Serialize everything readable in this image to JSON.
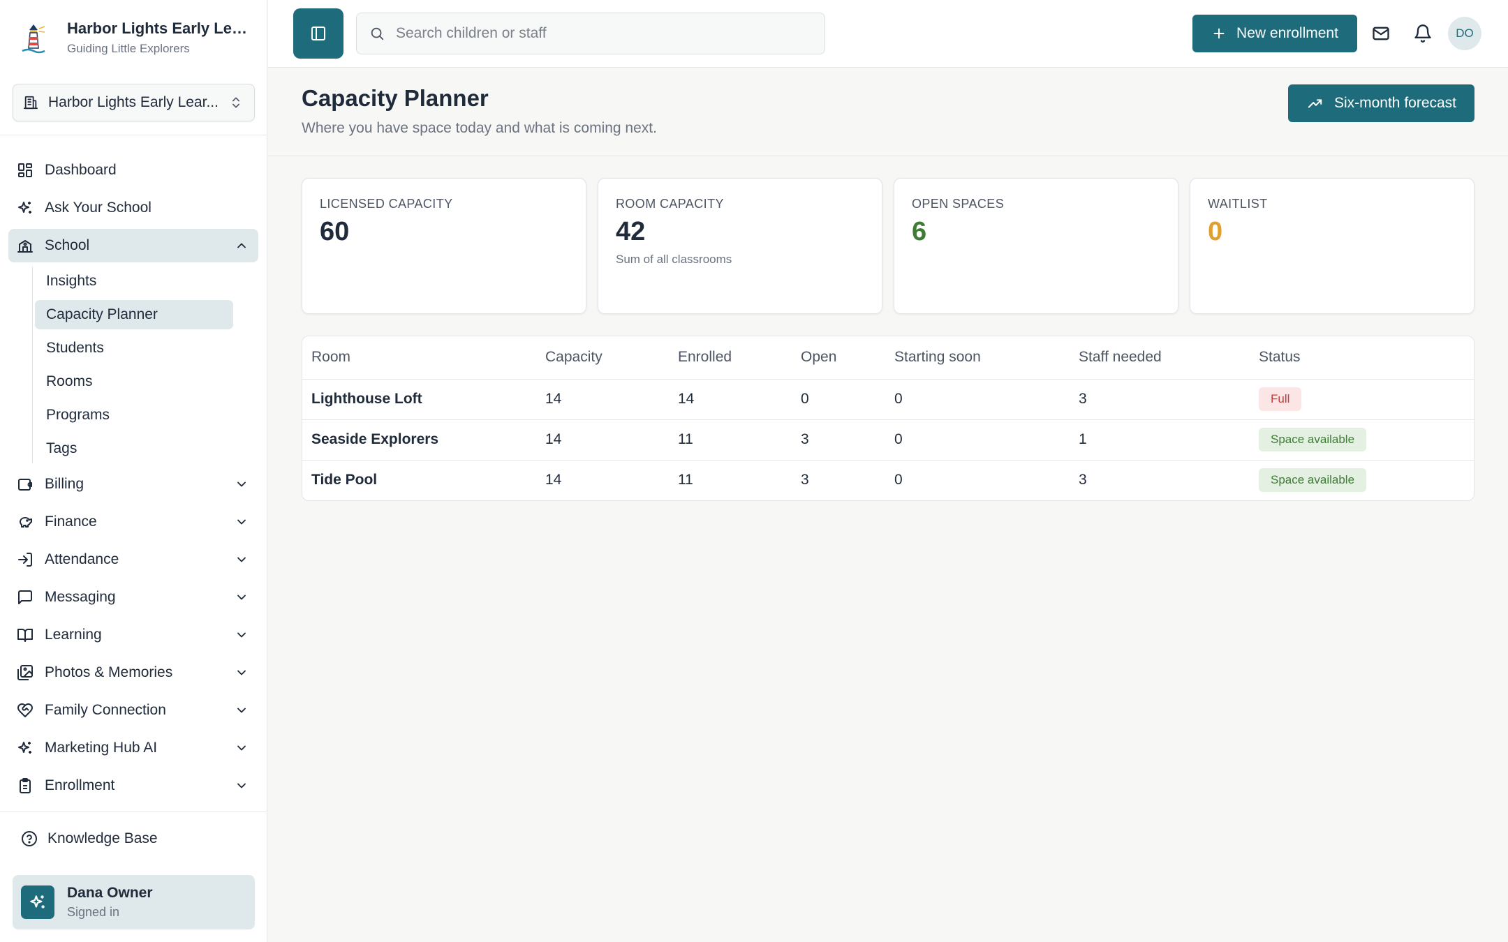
{
  "colors": {
    "primary": "#1e6b7b",
    "active_bg": "#dfe9ec",
    "open_spaces": "#3f7a36",
    "waitlist": "#e0a030",
    "full_bg": "#fbe5e5",
    "full_text": "#c43b3b",
    "available_bg": "#e4f0e2",
    "available_text": "#3f7a36"
  },
  "brand": {
    "name": "Harbor Lights Early Learn...",
    "tagline": "Guiding Little Explorers",
    "icon": "lighthouse-icon"
  },
  "school_selector": {
    "value": "Harbor Lights Early Lear...",
    "icon": "building-icon"
  },
  "sidebar": {
    "items": [
      {
        "label": "Dashboard",
        "icon": "dashboard-icon"
      },
      {
        "label": "Ask Your School",
        "icon": "sparkles-icon"
      },
      {
        "label": "School",
        "icon": "school-icon",
        "expanded": true,
        "children": [
          "Insights",
          "Capacity Planner",
          "Students",
          "Rooms",
          "Programs",
          "Tags"
        ],
        "active_child": "Capacity Planner"
      },
      {
        "label": "Billing",
        "icon": "wallet-icon"
      },
      {
        "label": "Finance",
        "icon": "piggy-bank-icon"
      },
      {
        "label": "Attendance",
        "icon": "sign-in-icon"
      },
      {
        "label": "Messaging",
        "icon": "message-square-icon"
      },
      {
        "label": "Learning",
        "icon": "book-open-icon"
      },
      {
        "label": "Photos & Memories",
        "icon": "images-icon"
      },
      {
        "label": "Family Connection",
        "icon": "heart-handshake-icon"
      },
      {
        "label": "Marketing Hub AI",
        "icon": "sparkles-icon"
      },
      {
        "label": "Enrollment",
        "icon": "clipboard-icon"
      }
    ],
    "knowledge_base": "Knowledge Base",
    "user": {
      "name": "Dana Owner",
      "status": "Signed in"
    }
  },
  "topbar": {
    "search_placeholder": "Search children or staff",
    "new_enrollment": "New enrollment",
    "avatar_initials": "DO"
  },
  "page": {
    "title": "Capacity Planner",
    "subtitle": "Where you have space today and what is coming next.",
    "forecast_button": "Six-month forecast"
  },
  "stats": [
    {
      "label": "LICENSED CAPACITY",
      "value": "60",
      "note": ""
    },
    {
      "label": "ROOM CAPACITY",
      "value": "42",
      "note": "Sum of all classrooms"
    },
    {
      "label": "OPEN SPACES",
      "value": "6",
      "note": ""
    },
    {
      "label": "WAITLIST",
      "value": "0",
      "note": ""
    }
  ],
  "table": {
    "headers": [
      "Room",
      "Capacity",
      "Enrolled",
      "Open",
      "Starting soon",
      "Staff needed",
      "Status"
    ],
    "rows": [
      {
        "room": "Lighthouse Loft",
        "capacity": "14",
        "enrolled": "14",
        "open": "0",
        "starting": "0",
        "staff": "3",
        "status": "Full"
      },
      {
        "room": "Seaside Explorers",
        "capacity": "14",
        "enrolled": "11",
        "open": "3",
        "starting": "0",
        "staff": "1",
        "status": "Space available"
      },
      {
        "room": "Tide Pool",
        "capacity": "14",
        "enrolled": "11",
        "open": "3",
        "starting": "0",
        "staff": "3",
        "status": "Space available"
      }
    ]
  }
}
